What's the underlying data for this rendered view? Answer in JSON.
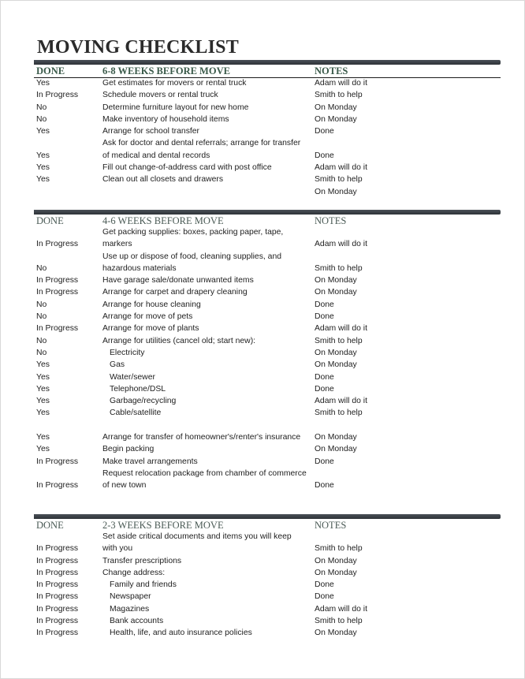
{
  "title": "MOVING CHECKLIST",
  "sections": [
    {
      "header": {
        "done": "DONE",
        "task": "6-8 WEEKS BEFORE MOVE",
        "notes": "NOTES"
      },
      "rows": [
        {
          "done": "Yes",
          "task": "Get estimates for movers or rental truck",
          "notes": "Adam will do it"
        },
        {
          "done": "In Progress",
          "task": "Schedule movers or rental truck",
          "notes": "Smith to help"
        },
        {
          "done": "No",
          "task": "Determine furniture layout for new home",
          "notes": "On Monday"
        },
        {
          "done": "No",
          "task": "Make inventory of household items",
          "notes": "On Monday"
        },
        {
          "done": "Yes",
          "task": "Arrange for school transfer",
          "notes": "Done"
        },
        {
          "done": "",
          "task": "Ask for doctor and dental referrals; arrange for transfer",
          "notes": ""
        },
        {
          "done": "Yes",
          "task": "of medical and dental records",
          "notes": "Done"
        },
        {
          "done": "Yes",
          "task": "Fill out change-of-address card with post office",
          "notes": "Adam will do it"
        },
        {
          "done": "Yes",
          "task": "Clean out all closets and drawers",
          "notes": "Smith to help"
        },
        {
          "done": "",
          "task": "",
          "notes": "On Monday"
        }
      ]
    },
    {
      "header": {
        "done": "DONE",
        "task": "4-6 WEEKS BEFORE MOVE",
        "notes": "NOTES"
      },
      "rows": [
        {
          "done": "",
          "task": "Get packing supplies: boxes, packing paper, tape,",
          "notes": ""
        },
        {
          "done": "In Progress",
          "task": "markers",
          "notes": "Adam will do it"
        },
        {
          "done": "",
          "task": "Use up or dispose of food, cleaning supplies, and",
          "notes": ""
        },
        {
          "done": "No",
          "task": "hazardous materials",
          "notes": "Smith to help"
        },
        {
          "done": "In Progress",
          "task": "Have garage sale/donate unwanted items",
          "notes": "On Monday"
        },
        {
          "done": "In Progress",
          "task": "Arrange for carpet and drapery cleaning",
          "notes": "On Monday"
        },
        {
          "done": "No",
          "task": "Arrange for house cleaning",
          "notes": "Done"
        },
        {
          "done": "No",
          "task": "Arrange for move of pets",
          "notes": "Done"
        },
        {
          "done": "In Progress",
          "task": "Arrange for move of plants",
          "notes": "Adam will do it"
        },
        {
          "done": "No",
          "task": "Arrange for utilities (cancel old; start new):",
          "notes": "Smith to help"
        },
        {
          "done": "No",
          "task": "Electricity",
          "notes": "On Monday",
          "indent": true
        },
        {
          "done": "Yes",
          "task": "Gas",
          "notes": "On Monday",
          "indent": true
        },
        {
          "done": "Yes",
          "task": "Water/sewer",
          "notes": "Done",
          "indent": true
        },
        {
          "done": "Yes",
          "task": "Telephone/DSL",
          "notes": "Done",
          "indent": true
        },
        {
          "done": "Yes",
          "task": "Garbage/recycling",
          "notes": "Adam will do it",
          "indent": true
        },
        {
          "done": "Yes",
          "task": "Cable/satellite",
          "notes": "Smith to help",
          "indent": true
        },
        {
          "done": "",
          "task": "",
          "notes": ""
        },
        {
          "done": "Yes",
          "task": "Arrange for transfer of homeowner's/renter's insurance",
          "notes": "On Monday"
        },
        {
          "done": "Yes",
          "task": "Begin packing",
          "notes": "On Monday"
        },
        {
          "done": "In Progress",
          "task": "Make travel arrangements",
          "notes": "Done"
        },
        {
          "done": "",
          "task": "Request relocation package from chamber of commerce",
          "notes": ""
        },
        {
          "done": "In Progress",
          "task": "of new town",
          "notes": "Done"
        }
      ]
    },
    {
      "header": {
        "done": "DONE",
        "task": "2-3 WEEKS BEFORE MOVE",
        "notes": "NOTES"
      },
      "rows": [
        {
          "done": "",
          "task": "Set aside critical documents and items you will keep",
          "notes": ""
        },
        {
          "done": "In Progress",
          "task": "with you",
          "notes": "Smith to help"
        },
        {
          "done": "In Progress",
          "task": "Transfer prescriptions",
          "notes": "On Monday"
        },
        {
          "done": "In Progress",
          "task": "Change address:",
          "notes": "On Monday"
        },
        {
          "done": "In Progress",
          "task": "Family and friends",
          "notes": "Done",
          "indent": true
        },
        {
          "done": "In Progress",
          "task": "Newspaper",
          "notes": "Done",
          "indent": true
        },
        {
          "done": "In Progress",
          "task": "Magazines",
          "notes": "Adam will do it",
          "indent": true
        },
        {
          "done": "In Progress",
          "task": "Bank accounts",
          "notes": "Smith to help",
          "indent": true
        },
        {
          "done": "In Progress",
          "task": "Health, life, and auto insurance policies",
          "notes": "On Monday",
          "indent": true
        }
      ]
    }
  ]
}
